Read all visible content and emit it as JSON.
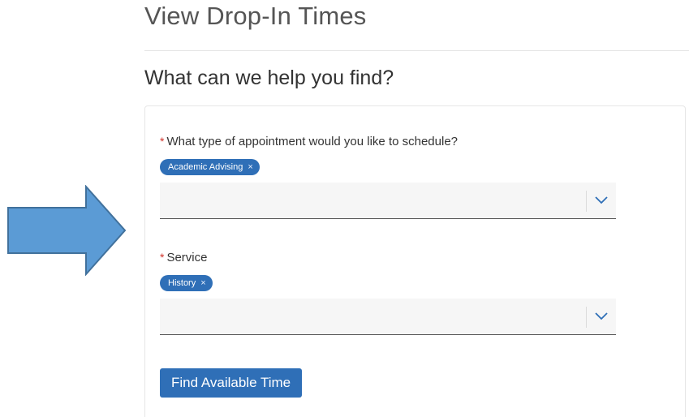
{
  "page": {
    "title": "View Drop-In Times",
    "section_heading": "What can we help you find?"
  },
  "form": {
    "appointment_type": {
      "label": "What type of appointment would you like to schedule?",
      "required": true,
      "selected_chip": "Academic Advising",
      "chip_remove_symbol": "×",
      "chevron_icon": "chevron-down-icon"
    },
    "service": {
      "label": "Service",
      "required": true,
      "selected_chip": "History",
      "chip_remove_symbol": "×",
      "chevron_icon": "chevron-down-icon"
    },
    "submit_label": "Find Available Time"
  },
  "annotation": {
    "shape": "right-arrow",
    "fill_color": "#5b9bd5",
    "stroke_color": "#41719c"
  },
  "colors": {
    "accent": "#2f6fb7",
    "required": "#d0342c"
  }
}
